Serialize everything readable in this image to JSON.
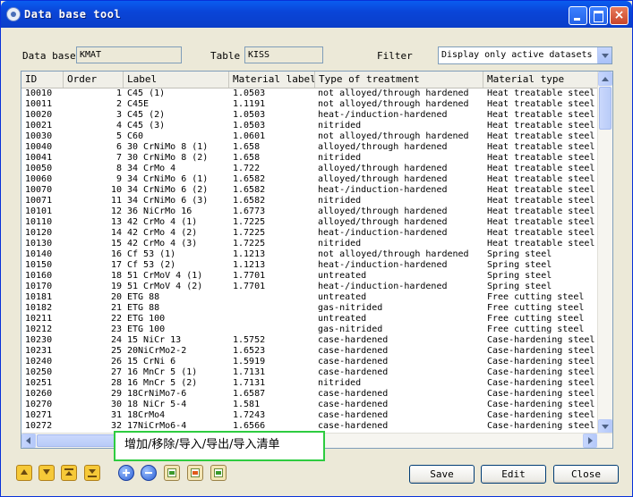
{
  "window": {
    "title": "Data base tool"
  },
  "fields": {
    "database_label": "Data base",
    "database_value": "KMAT",
    "table_label": "Table",
    "table_value": "KISS",
    "filter_label": "Filter",
    "filter_value": "Display only active datasets"
  },
  "columns": [
    "ID",
    "Order",
    "Label",
    "Material label",
    "Type of treatment",
    "Material type"
  ],
  "rows": [
    [
      "10010",
      "1",
      "C45 (1)",
      "1.0503",
      "not alloyed/through hardened",
      "Heat treatable steel"
    ],
    [
      "10011",
      "2",
      "C45E",
      "1.1191",
      "not alloyed/through hardened",
      "Heat treatable steel"
    ],
    [
      "10020",
      "3",
      "C45 (2)",
      "1.0503",
      "heat-/induction-hardened",
      "Heat treatable steel"
    ],
    [
      "10021",
      "4",
      "C45 (3)",
      "1.0503",
      "nitrided",
      "Heat treatable steel"
    ],
    [
      "10030",
      "5",
      "C60",
      "1.0601",
      "not alloyed/through hardened",
      "Heat treatable steel"
    ],
    [
      "10040",
      "6",
      "30 CrNiMo 8 (1)",
      "1.658",
      "alloyed/through hardened",
      "Heat treatable steel"
    ],
    [
      "10041",
      "7",
      "30 CrNiMo 8 (2)",
      "1.658",
      "nitrided",
      "Heat treatable steel"
    ],
    [
      "10050",
      "8",
      "34 CrMo 4",
      "1.722",
      "alloyed/through hardened",
      "Heat treatable steel"
    ],
    [
      "10060",
      "9",
      "34 CrNiMo 6 (1)",
      "1.6582",
      "alloyed/through hardened",
      "Heat treatable steel"
    ],
    [
      "10070",
      "10",
      "34 CrNiMo 6 (2)",
      "1.6582",
      "heat-/induction-hardened",
      "Heat treatable steel"
    ],
    [
      "10071",
      "11",
      "34 CrNiMo 6 (3)",
      "1.6582",
      "nitrided",
      "Heat treatable steel"
    ],
    [
      "10101",
      "12",
      "36 NiCrMo 16",
      "1.6773",
      "alloyed/through hardened",
      "Heat treatable steel"
    ],
    [
      "10110",
      "13",
      "42 CrMo 4 (1)",
      "1.7225",
      "alloyed/through hardened",
      "Heat treatable steel"
    ],
    [
      "10120",
      "14",
      "42 CrMo 4 (2)",
      "1.7225",
      "heat-/induction-hardened",
      "Heat treatable steel"
    ],
    [
      "10130",
      "15",
      "42 CrMo 4 (3)",
      "1.7225",
      "nitrided",
      "Heat treatable steel"
    ],
    [
      "10140",
      "16",
      "Cf 53 (1)",
      "1.1213",
      "not alloyed/through hardened",
      "Spring steel"
    ],
    [
      "10150",
      "17",
      "Cf 53 (2)",
      "1.1213",
      "heat-/induction-hardened",
      "Spring steel"
    ],
    [
      "10160",
      "18",
      "51 CrMoV 4 (1)",
      "1.7701",
      "untreated",
      "Spring steel"
    ],
    [
      "10170",
      "19",
      "51 CrMoV 4 (2)",
      "1.7701",
      "heat-/induction-hardened",
      "Spring steel"
    ],
    [
      "10181",
      "20",
      "ETG 88",
      "",
      "untreated",
      "Free cutting steel"
    ],
    [
      "10182",
      "21",
      "ETG 88",
      "",
      "gas-nitrided",
      "Free cutting steel"
    ],
    [
      "10211",
      "22",
      "ETG 100",
      "",
      "untreated",
      "Free cutting steel"
    ],
    [
      "10212",
      "23",
      "ETG 100",
      "",
      "gas-nitrided",
      "Free cutting steel"
    ],
    [
      "10230",
      "24",
      "15 NiCr 13",
      "1.5752",
      "case-hardened",
      "Case-hardening steel"
    ],
    [
      "10231",
      "25",
      "20NiCrMo2-2",
      "1.6523",
      "case-hardened",
      "Case-hardening steel"
    ],
    [
      "10240",
      "26",
      "15 CrNi 6",
      "1.5919",
      "case-hardened",
      "Case-hardening steel"
    ],
    [
      "10250",
      "27",
      "16 MnCr 5 (1)",
      "1.7131",
      "case-hardened",
      "Case-hardening steel"
    ],
    [
      "10251",
      "28",
      "16 MnCr 5 (2)",
      "1.7131",
      "nitrided",
      "Case-hardening steel"
    ],
    [
      "10260",
      "29",
      "18CrNiMo7-6",
      "1.6587",
      "case-hardened",
      "Case-hardening steel"
    ],
    [
      "10270",
      "30",
      "18 NiCr 5-4",
      "1.581",
      "case-hardened",
      "Case-hardening steel"
    ],
    [
      "10271",
      "31",
      "18CrMo4",
      "1.7243",
      "case-hardened",
      "Case-hardening steel"
    ],
    [
      "10272",
      "32",
      "17NiCrMo6-4",
      "1.6566",
      "case-hardened",
      "Case-hardening steel"
    ]
  ],
  "tooltip": "增加/移除/导入/导出/导入清单",
  "icons": {
    "nav": [
      "move-up-icon",
      "move-down-icon",
      "move-top-icon",
      "move-bottom-icon"
    ],
    "list": [
      "add-icon",
      "remove-icon",
      "import-icon",
      "export-icon",
      "import-list-icon"
    ]
  },
  "buttons": {
    "save": "Save",
    "edit": "Edit",
    "close": "Close"
  }
}
